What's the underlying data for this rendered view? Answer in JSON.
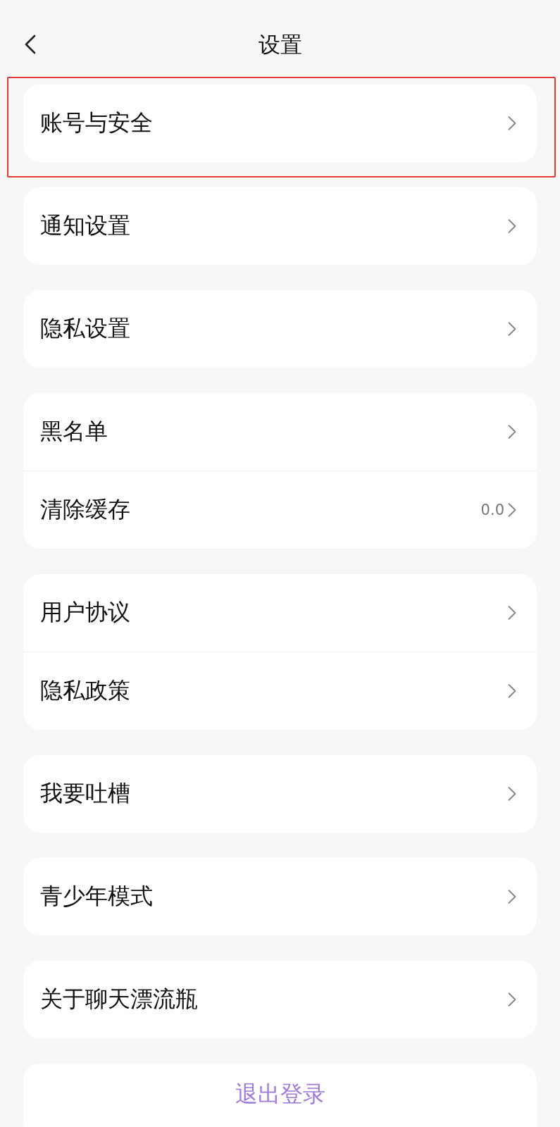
{
  "header": {
    "title": "设置"
  },
  "groups": [
    {
      "highlighted": true,
      "items": [
        {
          "label": "账号与安全"
        }
      ]
    },
    {
      "highlighted": false,
      "items": [
        {
          "label": "通知设置"
        }
      ]
    },
    {
      "highlighted": false,
      "items": [
        {
          "label": "隐私设置"
        }
      ]
    },
    {
      "highlighted": false,
      "items": [
        {
          "label": "黑名单"
        },
        {
          "label": "清除缓存",
          "value": "0.0"
        }
      ]
    },
    {
      "highlighted": false,
      "items": [
        {
          "label": "用户协议"
        },
        {
          "label": "隐私政策"
        }
      ]
    },
    {
      "highlighted": false,
      "items": [
        {
          "label": "我要吐槽"
        }
      ]
    },
    {
      "highlighted": false,
      "items": [
        {
          "label": "青少年模式"
        }
      ]
    },
    {
      "highlighted": false,
      "items": [
        {
          "label": "关于聊天漂流瓶"
        }
      ]
    }
  ],
  "logout": {
    "label": "退出登录"
  }
}
